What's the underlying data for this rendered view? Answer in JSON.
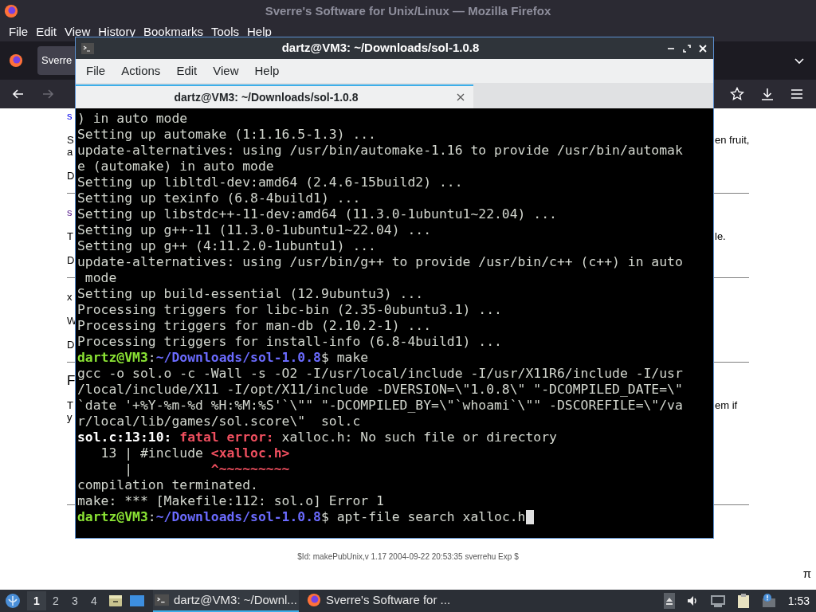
{
  "firefox": {
    "title": "Sverre's Software for Unix/Linux — Mozilla Firefox",
    "menu": [
      "File",
      "Edit",
      "View",
      "History",
      "Bookmarks",
      "Tools",
      "Help"
    ],
    "tab": {
      "label": "Sverre"
    }
  },
  "page": {
    "blocks": [
      {
        "kind": "link",
        "visited": false,
        "lines": [
          {
            "left": "s"
          }
        ]
      },
      {
        "kind": "para",
        "lines": [
          {
            "left": "S",
            "right": "en fruit,"
          },
          {
            "left": "a"
          }
        ]
      },
      {
        "kind": "para",
        "lines": [
          {
            "left": "D"
          }
        ]
      },
      {
        "kind": "rule"
      },
      {
        "kind": "link",
        "visited": true,
        "lines": [
          {
            "left": "s"
          }
        ]
      },
      {
        "kind": "para",
        "lines": [
          {
            "left": "T",
            "right": "le."
          }
        ]
      },
      {
        "kind": "para",
        "lines": [
          {
            "left": "D"
          }
        ]
      },
      {
        "kind": "rule"
      },
      {
        "kind": "para",
        "lines": [
          {
            "left": "x"
          }
        ]
      },
      {
        "kind": "para",
        "lines": [
          {
            "left": "W"
          }
        ]
      },
      {
        "kind": "para",
        "lines": [
          {
            "left": "D"
          }
        ]
      },
      {
        "kind": "rule"
      },
      {
        "kind": "heading",
        "lines": [
          {
            "left": "F"
          }
        ]
      },
      {
        "kind": "para",
        "lines": [
          {
            "left": "T",
            "right": "em if"
          },
          {
            "left": "y"
          }
        ]
      }
    ],
    "footer": "$Id: makePubUnix,v 1.17 2004-09-22 20:53:35 sverrehu Exp $",
    "corner": "π"
  },
  "terminal": {
    "title": "dartz@VM3: ~/Downloads/sol-1.0.8",
    "menu": [
      "File",
      "Actions",
      "Edit",
      "View",
      "Help"
    ],
    "tabs": [
      {
        "label": "dartz@VM3: ~/Downloads/sol-1.0.8",
        "selected": true
      }
    ],
    "lines": [
      {
        "segments": [
          {
            "kind": "plain",
            "text": ") in auto mode"
          }
        ]
      },
      {
        "segments": [
          {
            "kind": "plain",
            "text": "Setting up automake (1:1.16.5-1.3) ..."
          }
        ]
      },
      {
        "segments": [
          {
            "kind": "plain",
            "text": "update-alternatives: using /usr/bin/automake-1.16 to provide /usr/bin/automak"
          }
        ]
      },
      {
        "segments": [
          {
            "kind": "plain",
            "text": "e (automake) in auto mode"
          }
        ]
      },
      {
        "segments": [
          {
            "kind": "plain",
            "text": "Setting up libltdl-dev:amd64 (2.4.6-15build2) ..."
          }
        ]
      },
      {
        "segments": [
          {
            "kind": "plain",
            "text": "Setting up texinfo (6.8-4build1) ..."
          }
        ]
      },
      {
        "segments": [
          {
            "kind": "plain",
            "text": "Setting up libstdc++-11-dev:amd64 (11.3.0-1ubuntu1~22.04) ..."
          }
        ]
      },
      {
        "segments": [
          {
            "kind": "plain",
            "text": "Setting up g++-11 (11.3.0-1ubuntu1~22.04) ..."
          }
        ]
      },
      {
        "segments": [
          {
            "kind": "plain",
            "text": "Setting up g++ (4:11.2.0-1ubuntu1) ..."
          }
        ]
      },
      {
        "segments": [
          {
            "kind": "plain",
            "text": "update-alternatives: using /usr/bin/g++ to provide /usr/bin/c++ (c++) in auto"
          }
        ]
      },
      {
        "segments": [
          {
            "kind": "plain",
            "text": " mode"
          }
        ]
      },
      {
        "segments": [
          {
            "kind": "plain",
            "text": "Setting up build-essential (12.9ubuntu3) ..."
          }
        ]
      },
      {
        "segments": [
          {
            "kind": "plain",
            "text": "Processing triggers for libc-bin (2.35-0ubuntu3.1) ..."
          }
        ]
      },
      {
        "segments": [
          {
            "kind": "plain",
            "text": "Processing triggers for man-db (2.10.2-1) ..."
          }
        ]
      },
      {
        "segments": [
          {
            "kind": "plain",
            "text": "Processing triggers for install-info (6.8-4build1) ..."
          }
        ]
      },
      {
        "segments": [
          {
            "kind": "user",
            "text": "dartz@VM3"
          },
          {
            "kind": "plain",
            "text": ":"
          },
          {
            "kind": "path",
            "text": "~/Downloads/sol-1.0.8"
          },
          {
            "kind": "plain",
            "text": "$ make"
          }
        ]
      },
      {
        "segments": [
          {
            "kind": "plain",
            "text": "gcc -o sol.o -c -Wall -s -O2 -I/usr/local/include -I/usr/X11R6/include -I/usr"
          }
        ]
      },
      {
        "segments": [
          {
            "kind": "plain",
            "text": "/local/include/X11 -I/opt/X11/include -DVERSION=\\\"1.0.8\\\" \"-DCOMPILED_DATE=\\\""
          }
        ]
      },
      {
        "segments": [
          {
            "kind": "plain",
            "text": "`date '+%Y-%m-%d %H:%M:%S'`\\\"\" \"-DCOMPILED_BY=\\\"`whoami`\\\"\" -DSCOREFILE=\\\"/va"
          }
        ]
      },
      {
        "segments": [
          {
            "kind": "plain",
            "text": "r/local/lib/games/sol.score\\\"  sol.c"
          }
        ]
      },
      {
        "segments": [
          {
            "kind": "bold",
            "text": "sol.c:13:10: "
          },
          {
            "kind": "error",
            "text": "fatal error: "
          },
          {
            "kind": "plain",
            "text": "xalloc.h: No such file or directory"
          }
        ]
      },
      {
        "segments": [
          {
            "kind": "plain",
            "text": "   13 | #include "
          },
          {
            "kind": "mark",
            "text": "<xalloc.h>"
          }
        ]
      },
      {
        "segments": [
          {
            "kind": "plain",
            "text": "      |          "
          },
          {
            "kind": "mark",
            "text": "^~~~~~~~~~"
          }
        ]
      },
      {
        "segments": [
          {
            "kind": "plain",
            "text": "compilation terminated."
          }
        ]
      },
      {
        "segments": [
          {
            "kind": "plain",
            "text": "make: *** [Makefile:112: sol.o] Error 1"
          }
        ]
      },
      {
        "segments": [
          {
            "kind": "user",
            "text": "dartz@VM3"
          },
          {
            "kind": "plain",
            "text": ":"
          },
          {
            "kind": "path",
            "text": "~/Downloads/sol-1.0.8"
          },
          {
            "kind": "plain",
            "text": "$ apt-file search xalloc.h"
          }
        ],
        "cursor": true
      }
    ]
  },
  "taskbar": {
    "workspaces": [
      {
        "label": "1",
        "selected": true
      },
      {
        "label": "2",
        "selected": false
      },
      {
        "label": "3",
        "selected": false
      },
      {
        "label": "4",
        "selected": false
      }
    ],
    "tasks": [
      {
        "kind": "terminal",
        "label": "dartz@VM3: ~/Downl...",
        "selected": true
      },
      {
        "kind": "browser",
        "label": "Sverre's Software for ...",
        "selected": false
      }
    ],
    "clock": "1:53"
  }
}
